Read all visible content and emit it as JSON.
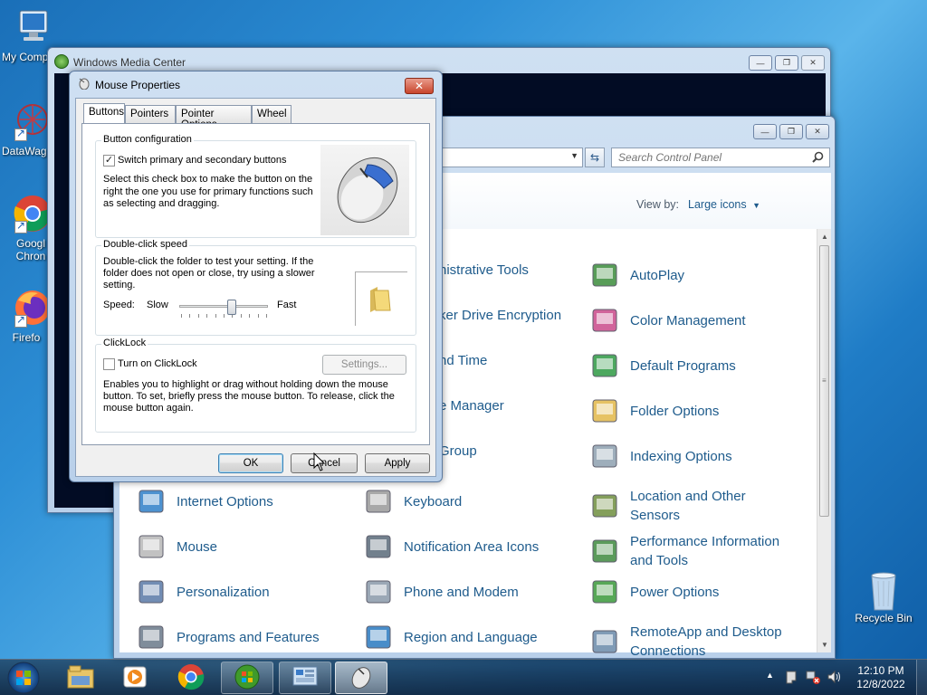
{
  "desktop": {
    "icons": [
      {
        "label": "My Comp"
      },
      {
        "label": "DataWag"
      },
      {
        "label": "Googl Chron"
      },
      {
        "label": "Firefo"
      },
      {
        "label": "Recycle Bin"
      }
    ]
  },
  "wmc": {
    "title": "Windows Media Center"
  },
  "control_panel": {
    "search_placeholder": "Search Control Panel",
    "view_by_label": "View by:",
    "view_by_value": "Large icons",
    "items": [
      {
        "label": "nistrative Tools",
        "icon": "admin-tools-icon"
      },
      {
        "label": "AutoPlay",
        "icon": "autoplay-icon"
      },
      {
        "label": "ker Drive Encryption",
        "icon": "bitlocker-icon"
      },
      {
        "label": "Color Management",
        "icon": "color-management-icon"
      },
      {
        "label": "nd Time",
        "icon": "date-time-icon"
      },
      {
        "label": "Default Programs",
        "icon": "default-programs-icon"
      },
      {
        "label": "e Manager",
        "icon": "device-manager-icon"
      },
      {
        "label": "Folder Options",
        "icon": "folder-options-icon"
      },
      {
        "label": "Group",
        "icon": "homegroup-icon"
      },
      {
        "label": "Indexing Options",
        "icon": "indexing-options-icon"
      },
      {
        "label": "Internet Options",
        "icon": "internet-options-icon"
      },
      {
        "label": "Keyboard",
        "icon": "keyboard-icon"
      },
      {
        "label": "Location and Other Sensors",
        "line1": "Location and Other",
        "line2": "Sensors",
        "icon": "location-sensors-icon"
      },
      {
        "label": "Mouse",
        "icon": "mouse-icon"
      },
      {
        "label": "Notification Area Icons",
        "icon": "notification-area-icon"
      },
      {
        "label": "Performance Information and Tools",
        "line1": "Performance Information",
        "line2": "and Tools",
        "icon": "performance-icon"
      },
      {
        "label": "Personalization",
        "icon": "personalization-icon"
      },
      {
        "label": "Phone and Modem",
        "icon": "phone-modem-icon"
      },
      {
        "label": "Power Options",
        "icon": "power-options-icon"
      },
      {
        "label": "Programs and Features",
        "icon": "programs-features-icon"
      },
      {
        "label": "Region and Language",
        "icon": "region-language-icon"
      },
      {
        "label": "RemoteApp and Desktop Connections",
        "line1": "RemoteApp and Desktop",
        "line2": "Connections",
        "icon": "remoteapp-icon"
      }
    ]
  },
  "mouse_dialog": {
    "title": "Mouse Properties",
    "tabs": [
      "Buttons",
      "Pointers",
      "Pointer Options",
      "Wheel"
    ],
    "button_config": {
      "title": "Button configuration",
      "checkbox_label": "Switch primary and secondary buttons",
      "checked": true,
      "desc1": "Select this check box to make the button on the",
      "desc2": "right the one you use for primary functions such",
      "desc3": "as selecting and dragging."
    },
    "double_click": {
      "title": "Double-click speed",
      "desc1": "Double-click the folder to test your setting. If the",
      "desc2": "folder does not open or close, try using a slower",
      "desc3": "setting.",
      "speed_label": "Speed:",
      "slow_label": "Slow",
      "fast_label": "Fast",
      "slider_value": 0.6
    },
    "clicklock": {
      "title": "ClickLock",
      "checkbox_label": "Turn on ClickLock",
      "checked": false,
      "settings_button": "Settings...",
      "desc1": "Enables you to highlight or drag without holding down the mouse",
      "desc2": "button. To set, briefly press the mouse button. To release, click the",
      "desc3": "mouse button again."
    },
    "ok_button": "OK",
    "cancel_button": "Cancel",
    "apply_button": "Apply"
  },
  "taskbar": {
    "time": "12:10 PM",
    "date": "12/8/2022"
  }
}
